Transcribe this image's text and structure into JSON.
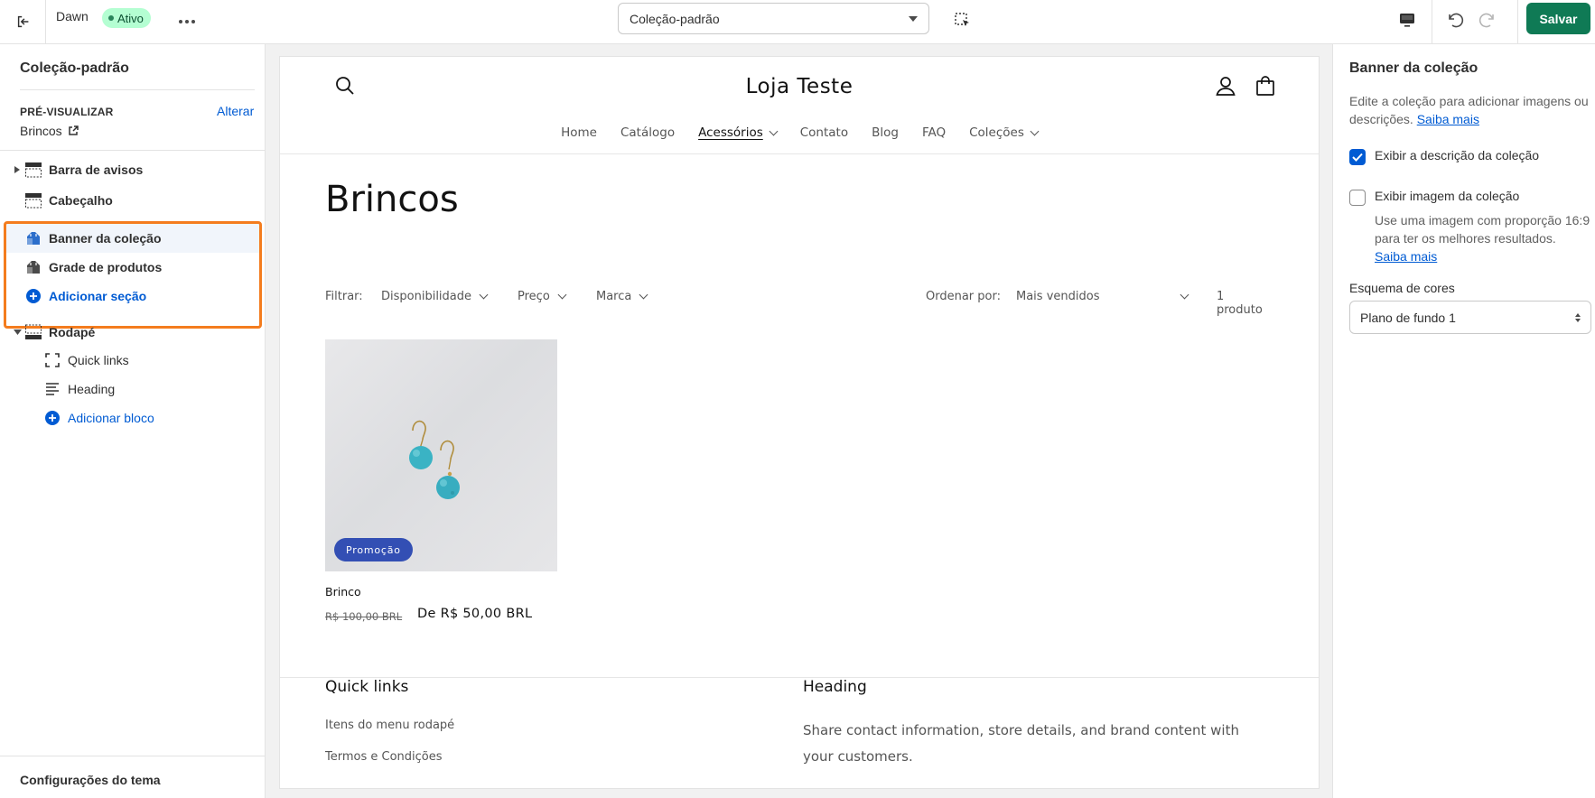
{
  "topbar": {
    "theme_name": "Dawn",
    "status_badge": "Ativo",
    "template_select_value": "Coleção-padrão",
    "save_label": "Salvar"
  },
  "sidebar": {
    "title": "Coleção-padrão",
    "preview_label": "PRÉ-VISUALIZAR",
    "preview_change": "Alterar",
    "preview_value": "Brincos",
    "sections": [
      {
        "label": "Barra de avisos",
        "icon": "announcement-bar-icon"
      },
      {
        "label": "Cabeçalho",
        "icon": "header-icon"
      },
      {
        "label": "Banner da coleção",
        "icon": "collection-banner-icon",
        "selected": true
      },
      {
        "label": "Grade de produtos",
        "icon": "product-grid-icon"
      },
      {
        "label": "Adicionar seção",
        "icon": "add-circle-icon"
      },
      {
        "label": "Rodapé",
        "icon": "footer-icon"
      },
      {
        "label": "Quick links",
        "icon": "block-icon"
      },
      {
        "label": "Heading",
        "icon": "text-icon"
      },
      {
        "label": "Adicionar bloco",
        "icon": "add-circle-icon"
      }
    ],
    "footer_label": "Configurações do tema",
    "highlight_color": "#f47c1e"
  },
  "preview": {
    "store_name": "Loja Teste",
    "nav": [
      {
        "label": "Home"
      },
      {
        "label": "Catálogo"
      },
      {
        "label": "Acessórios",
        "has_dropdown": true,
        "active": true
      },
      {
        "label": "Contato"
      },
      {
        "label": "Blog"
      },
      {
        "label": "FAQ"
      },
      {
        "label": "Coleções",
        "has_dropdown": true
      }
    ],
    "collection_title": "Brincos",
    "filter_label": "Filtrar:",
    "filters": [
      "Disponibilidade",
      "Preço",
      "Marca"
    ],
    "sort_label": "Ordenar por:",
    "sort_value": "Mais vendidos",
    "product_count": "1 produto",
    "product": {
      "badge": "Promoção",
      "name": "Brinco",
      "old_price": "R$ 100,00 BRL",
      "price": "De R$ 50,00 BRL"
    },
    "footer": {
      "col1_heading": "Quick links",
      "links": [
        "Itens do menu rodapé",
        "Termos e Condições"
      ],
      "col2_heading": "Heading",
      "col2_text": "Share contact information, store details, and brand content with your customers."
    }
  },
  "settings": {
    "title": "Banner da coleção",
    "description": "Edite a coleção para adicionar imagens ou descrições.",
    "learn_more": "Saiba mais",
    "show_description_label": "Exibir a descrição da coleção",
    "show_description_checked": true,
    "show_image_label": "Exibir imagem da coleção",
    "show_image_checked": false,
    "image_help": "Use uma imagem com proporção 16:9 para ter os melhores resultados.",
    "image_help_link": "Saiba mais",
    "color_scheme_label": "Esquema de cores",
    "color_scheme_value": "Plano de fundo 1"
  },
  "colors": {
    "primary_button": "#0f7a55",
    "link": "#005bd3",
    "sale_badge": "#334fb4"
  }
}
